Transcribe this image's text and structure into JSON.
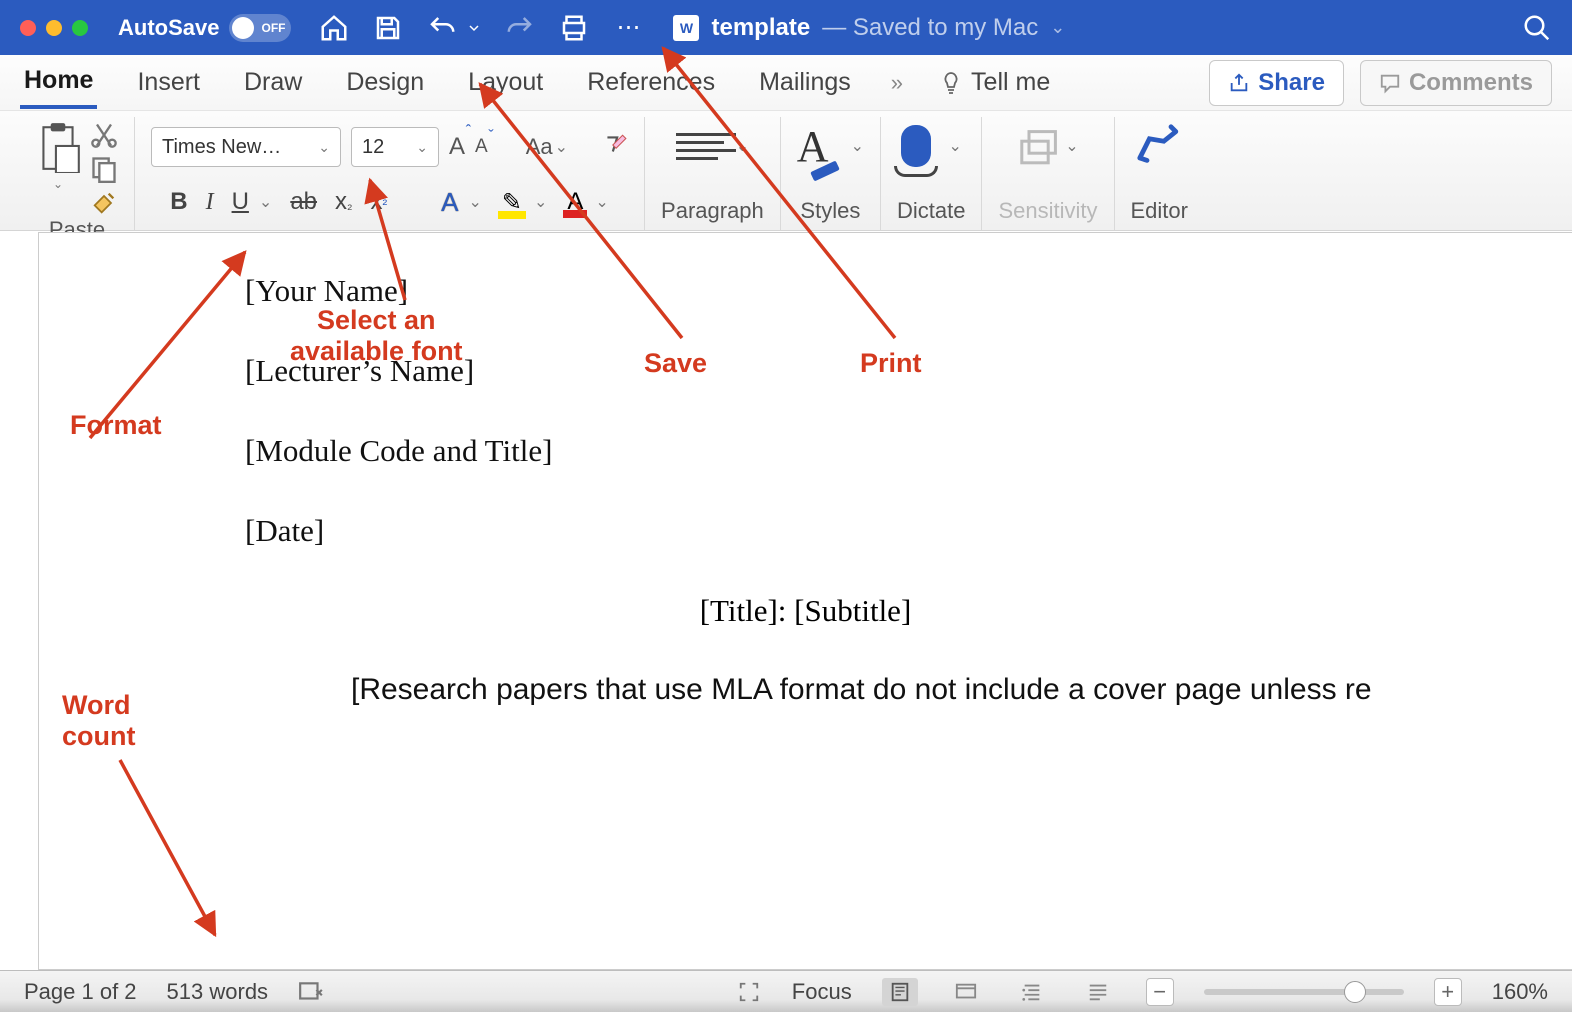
{
  "titlebar": {
    "autosave_label": "AutoSave",
    "autosave_state": "OFF",
    "doc_title": "template",
    "doc_subtitle": "— Saved to my Mac"
  },
  "tabs": {
    "home": "Home",
    "insert": "Insert",
    "draw": "Draw",
    "design": "Design",
    "layout": "Layout",
    "references": "References",
    "mailings": "Mailings",
    "tell_me": "Tell me",
    "share": "Share",
    "comments": "Comments"
  },
  "ribbon": {
    "paste": "Paste",
    "font_name": "Times New…",
    "font_size": "12",
    "change_case": "Aa",
    "bold": "B",
    "italic": "I",
    "underline": "U",
    "strike": "ab",
    "sub": "x",
    "sup": "x",
    "paragraph": "Paragraph",
    "styles": "Styles",
    "dictate": "Dictate",
    "sensitivity": "Sensitivity",
    "editor": "Editor"
  },
  "document": {
    "line1": "[Your Name]",
    "line2": "[Lecturer’s Name]",
    "line3": "[Module Code and Title]",
    "line4": "[Date]",
    "title": "[Title]: [Subtitle]",
    "body1": "[Research papers that use MLA format do not include a cover page unless re"
  },
  "statusbar": {
    "page": "Page 1 of 2",
    "words": "513 words",
    "focus": "Focus",
    "zoom": "160%",
    "minus": "−",
    "plus": "+"
  },
  "annotations": {
    "save": "Save",
    "print": "Print",
    "select_font": "Select an\navailable font",
    "format": "Format",
    "word_count": "Word\ncount"
  }
}
